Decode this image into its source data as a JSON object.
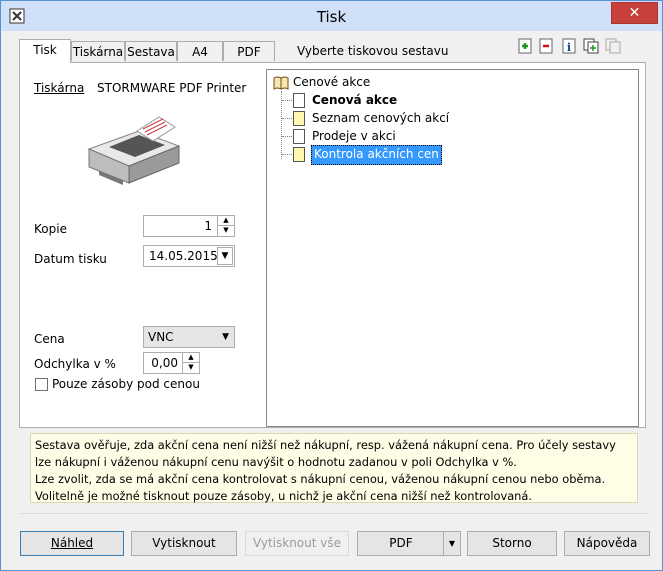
{
  "window": {
    "title": "Tisk",
    "close_glyph": "✕"
  },
  "tabs": [
    {
      "label": "Tisk",
      "active": true
    },
    {
      "label": "Tiskárna",
      "active": false
    },
    {
      "label": "Sestava",
      "active": false
    },
    {
      "label": "A4",
      "active": false
    },
    {
      "label": "PDF",
      "active": false
    }
  ],
  "hint": "Vyberte tiskovou sestavu",
  "toolbar_icons": [
    "add-icon",
    "remove-icon",
    "info-icon",
    "copy-report-icon",
    "duplicate-icon"
  ],
  "printer": {
    "label": "Tiskárna",
    "name": "STORMWARE PDF Printer"
  },
  "fields": {
    "kopie_label": "Kopie",
    "kopie_value": "1",
    "datum_label": "Datum tisku",
    "datum_value": "14.05.2015",
    "cena_label": "Cena",
    "cena_value": "VNC",
    "odchylka_label": "Odchylka v %",
    "odchylka_value": "0,00",
    "checkbox_label": "Pouze zásoby pod cenou"
  },
  "tree": {
    "root": "Cenové akce",
    "items": [
      {
        "label": "Cenová akce",
        "bold": true
      },
      {
        "label": "Seznam cenových akcí",
        "bold": false
      },
      {
        "label": "Prodeje v akci",
        "bold": false
      },
      {
        "label": "Kontrola akčních cen",
        "bold": false,
        "selected": true
      }
    ]
  },
  "description": [
    "Sestava ověřuje, zda akční cena není nižší než nákupní, resp. vážená nákupní cena. Pro účely sestavy lze nákupní i váženou nákupní cenu navýšit o hodnotu zadanou v poli Odchylka v %.",
    "Lze zvolit, zda se má akční cena kontrolovat s nákupní cenou, váženou nákupní cenou nebo oběma. Volitelně je možné tisknout pouze zásoby, u nichž je akční cena nižší než kontrolovaná."
  ],
  "buttons": {
    "nahled": "Náhled",
    "vytisknout": "Vytisknout",
    "vytisknout_vse": "Vytisknout vše",
    "pdf": "PDF",
    "storno": "Storno",
    "napoveda": "Nápověda"
  },
  "colors": {
    "selection": "#3399ff",
    "titlebar": "#cfe0f8",
    "close": "#c7403a"
  }
}
